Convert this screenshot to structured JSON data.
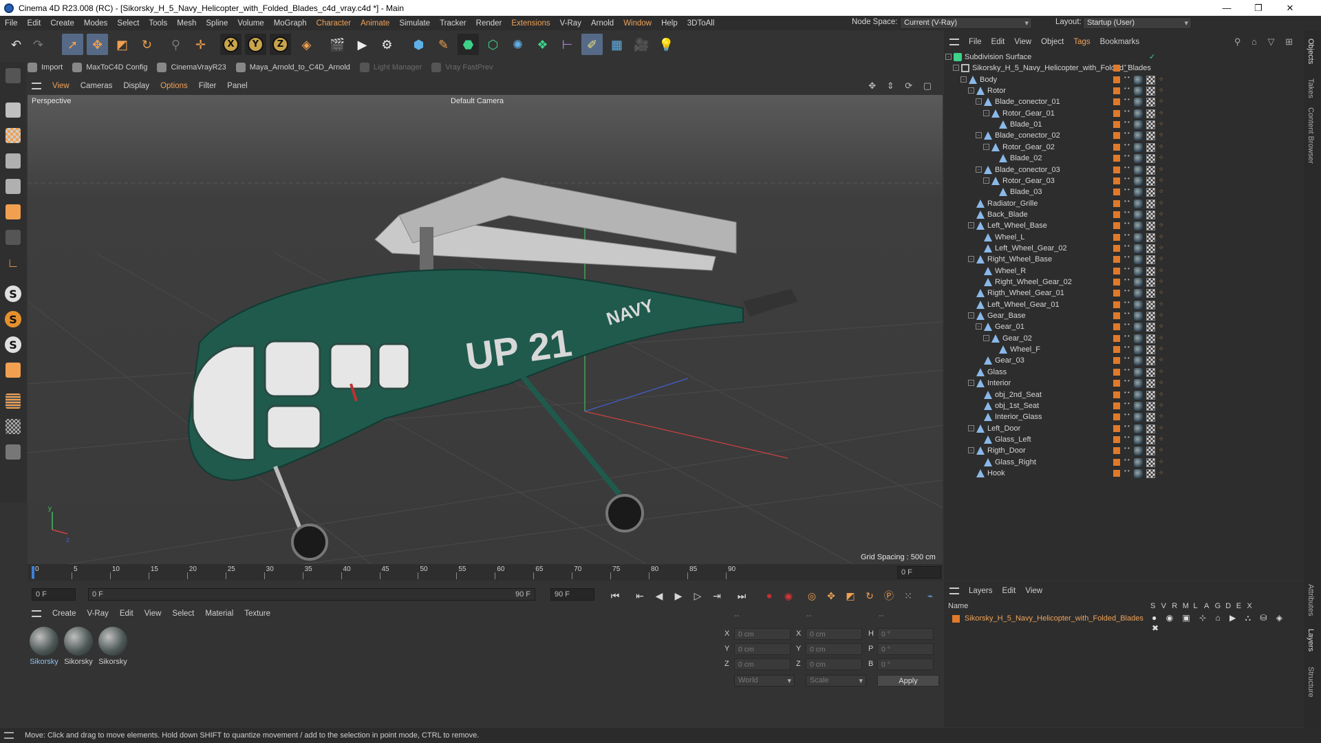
{
  "window": {
    "title": "Cinema 4D R23.008 (RC) - [Sikorsky_H_5_Navy_Helicopter_with_Folded_Blades_c4d_vray.c4d *] - Main",
    "min": "—",
    "restore": "❐",
    "close": "✕"
  },
  "menubar": {
    "items": [
      "File",
      "Edit",
      "Create",
      "Modes",
      "Select",
      "Tools",
      "Mesh",
      "Spline",
      "Volume",
      "MoGraph",
      "Character",
      "Animate",
      "Simulate",
      "Tracker",
      "Render",
      "Extensions",
      "V-Ray",
      "Arnold",
      "Window",
      "Help",
      "3DToAll"
    ],
    "node_space_label": "Node Space:",
    "node_space_value": "Current (V-Ray)",
    "layout_label": "Layout:",
    "layout_value": "Startup (User)"
  },
  "toolbar": {
    "axis_x": "X",
    "axis_y": "Y",
    "axis_z": "Z"
  },
  "pluginbar": {
    "items": [
      "Import",
      "MaxToC4D Config",
      "CinemaVrayR23",
      "Maya_Arnold_to_C4D_Arnold",
      "Light Manager",
      "Vray FastPrev"
    ]
  },
  "viewport": {
    "menu": [
      "View",
      "Cameras",
      "Display",
      "Options",
      "Filter",
      "Panel"
    ],
    "label": "Perspective",
    "camera": "Default Camera",
    "grid_spacing": "Grid Spacing : 500 cm",
    "axis_y": "y",
    "axis_z": "z",
    "decals": {
      "code": "UP 21",
      "navy": "NAVY"
    }
  },
  "timeline": {
    "ticks": [
      "0",
      "5",
      "10",
      "15",
      "20",
      "25",
      "30",
      "35",
      "40",
      "45",
      "50",
      "55",
      "60",
      "65",
      "70",
      "75",
      "80",
      "85",
      "90"
    ],
    "current_frame": "0 F"
  },
  "transport": {
    "start": "0 F",
    "range_start": "0 F",
    "range_end": "90 F",
    "end": "90 F"
  },
  "materials": {
    "menu": [
      "Create",
      "V-Ray",
      "Edit",
      "View",
      "Select",
      "Material",
      "Texture"
    ],
    "items": [
      "Sikorsky",
      "Sikorsky",
      "Sikorsky"
    ]
  },
  "coords": {
    "head1": "--",
    "head2": "--",
    "head3": "--",
    "x_label": "X",
    "y_label": "Y",
    "z_label": "Z",
    "pos_x": "0 cm",
    "pos_y": "0 cm",
    "pos_z": "0 cm",
    "size_x_label": "X",
    "size_y_label": "Y",
    "size_z_label": "Z",
    "size_x": "0 cm",
    "size_y": "0 cm",
    "size_z": "0 cm",
    "h_label": "H",
    "p_label": "P",
    "b_label": "B",
    "rot_h": "0 °",
    "rot_p": "0 °",
    "rot_b": "0 °",
    "mode1": "World",
    "mode2": "Scale",
    "apply": "Apply"
  },
  "statusbar": {
    "text": "Move: Click and drag to move elements. Hold down SHIFT to quantize movement / add to the selection in point mode, CTRL to remove."
  },
  "objects": {
    "menu": [
      "File",
      "Edit",
      "View",
      "Object",
      "Tags",
      "Bookmarks"
    ],
    "tree": [
      {
        "name": "Subdivision Surface",
        "depth": 0,
        "toggle": "-",
        "kind": "subd"
      },
      {
        "name": "Sikorsky_H_5_Navy_Helicopter_with_Folded_Blades",
        "depth": 1,
        "toggle": "-",
        "kind": "null"
      },
      {
        "name": "Body",
        "depth": 2,
        "toggle": "-",
        "kind": "mesh"
      },
      {
        "name": "Rotor",
        "depth": 3,
        "toggle": "-",
        "kind": "mesh"
      },
      {
        "name": "Blade_conector_01",
        "depth": 4,
        "toggle": "-",
        "kind": "mesh"
      },
      {
        "name": "Rotor_Gear_01",
        "depth": 5,
        "toggle": "-",
        "kind": "mesh"
      },
      {
        "name": "Blade_01",
        "depth": 6,
        "toggle": "",
        "kind": "mesh"
      },
      {
        "name": "Blade_conector_02",
        "depth": 4,
        "toggle": "-",
        "kind": "mesh"
      },
      {
        "name": "Rotor_Gear_02",
        "depth": 5,
        "toggle": "-",
        "kind": "mesh"
      },
      {
        "name": "Blade_02",
        "depth": 6,
        "toggle": "",
        "kind": "mesh"
      },
      {
        "name": "Blade_conector_03",
        "depth": 4,
        "toggle": "-",
        "kind": "mesh"
      },
      {
        "name": "Rotor_Gear_03",
        "depth": 5,
        "toggle": "-",
        "kind": "mesh"
      },
      {
        "name": "Blade_03",
        "depth": 6,
        "toggle": "",
        "kind": "mesh"
      },
      {
        "name": "Radiator_Grille",
        "depth": 3,
        "toggle": "",
        "kind": "mesh"
      },
      {
        "name": "Back_Blade",
        "depth": 3,
        "toggle": "",
        "kind": "mesh"
      },
      {
        "name": "Left_Wheel_Base",
        "depth": 3,
        "toggle": "-",
        "kind": "mesh"
      },
      {
        "name": "Wheel_L",
        "depth": 4,
        "toggle": "",
        "kind": "mesh"
      },
      {
        "name": "Left_Wheel_Gear_02",
        "depth": 4,
        "toggle": "",
        "kind": "mesh"
      },
      {
        "name": "Right_Wheel_Base",
        "depth": 3,
        "toggle": "-",
        "kind": "mesh"
      },
      {
        "name": "Wheel_R",
        "depth": 4,
        "toggle": "",
        "kind": "mesh"
      },
      {
        "name": "Right_Wheel_Gear_02",
        "depth": 4,
        "toggle": "",
        "kind": "mesh"
      },
      {
        "name": "Rigth_Wheel_Gear_01",
        "depth": 3,
        "toggle": "",
        "kind": "mesh"
      },
      {
        "name": "Left_Wheel_Gear_01",
        "depth": 3,
        "toggle": "",
        "kind": "mesh"
      },
      {
        "name": "Gear_Base",
        "depth": 3,
        "toggle": "-",
        "kind": "mesh"
      },
      {
        "name": "Gear_01",
        "depth": 4,
        "toggle": "-",
        "kind": "mesh"
      },
      {
        "name": "Gear_02",
        "depth": 5,
        "toggle": "-",
        "kind": "mesh"
      },
      {
        "name": "Wheel_F",
        "depth": 6,
        "toggle": "",
        "kind": "mesh"
      },
      {
        "name": "Gear_03",
        "depth": 4,
        "toggle": "",
        "kind": "mesh"
      },
      {
        "name": "Glass",
        "depth": 3,
        "toggle": "",
        "kind": "mesh"
      },
      {
        "name": "Interior",
        "depth": 3,
        "toggle": "-",
        "kind": "mesh"
      },
      {
        "name": "obj_2nd_Seat",
        "depth": 4,
        "toggle": "",
        "kind": "mesh"
      },
      {
        "name": "obj_1st_Seat",
        "depth": 4,
        "toggle": "",
        "kind": "mesh"
      },
      {
        "name": "Interior_Glass",
        "depth": 4,
        "toggle": "",
        "kind": "mesh"
      },
      {
        "name": "Left_Door",
        "depth": 3,
        "toggle": "-",
        "kind": "mesh"
      },
      {
        "name": "Glass_Left",
        "depth": 4,
        "toggle": "",
        "kind": "mesh"
      },
      {
        "name": "Rigth_Door",
        "depth": 3,
        "toggle": "-",
        "kind": "mesh"
      },
      {
        "name": "Glass_Right",
        "depth": 4,
        "toggle": "",
        "kind": "mesh"
      },
      {
        "name": "Hook",
        "depth": 3,
        "toggle": "",
        "kind": "mesh"
      }
    ]
  },
  "layers": {
    "menu": [
      "Layers",
      "Edit",
      "View"
    ],
    "name_header": "Name",
    "columns": [
      "S",
      "V",
      "R",
      "M",
      "L",
      "A",
      "G",
      "D",
      "E",
      "X"
    ],
    "row": "Sikorsky_H_5_Navy_Helicopter_with_Folded_Blades"
  },
  "right_tabs": [
    "Objects",
    "Takes",
    "Content Browser",
    "Attributes",
    "Layers",
    "Structure"
  ],
  "colors": {
    "accent": "#f0a35a",
    "layer_color": "#e07a2a",
    "selection": "#566a88"
  }
}
